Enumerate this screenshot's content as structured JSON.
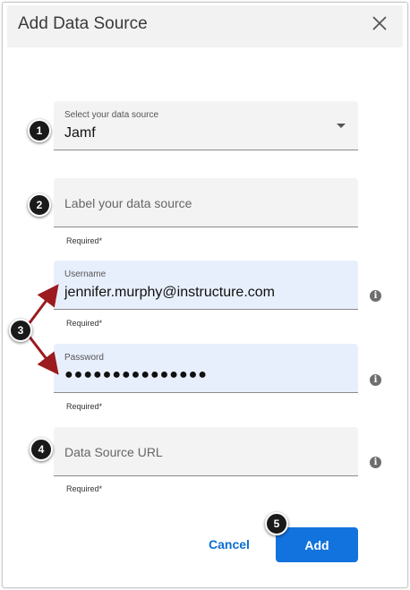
{
  "dialog": {
    "title": "Add Data Source",
    "close_icon": "close-icon"
  },
  "fields": {
    "data_source": {
      "label": "Select your data source",
      "value": "Jamf",
      "icon": "dropdown-caret-icon"
    },
    "label": {
      "placeholder": "Label your data source",
      "helper": "Required*"
    },
    "username": {
      "label": "Username",
      "value": "jennifer.murphy@instructure.com",
      "helper": "Required*",
      "info_icon": "info-icon"
    },
    "password": {
      "label": "Password",
      "value": "●●●●●●●●●●●●●●●",
      "helper": "Required*",
      "info_icon": "info-icon"
    },
    "url": {
      "placeholder": "Data Source URL",
      "helper": "Required*",
      "info_icon": "info-icon"
    }
  },
  "buttons": {
    "cancel": "Cancel",
    "add": "Add"
  },
  "callouts": [
    "1",
    "2",
    "3",
    "4",
    "5"
  ],
  "colors": {
    "accent": "#1273de",
    "link": "#0b6fd0",
    "callout_arrow": "#9b1b1f",
    "filled_field_bg": "#e8effc"
  }
}
